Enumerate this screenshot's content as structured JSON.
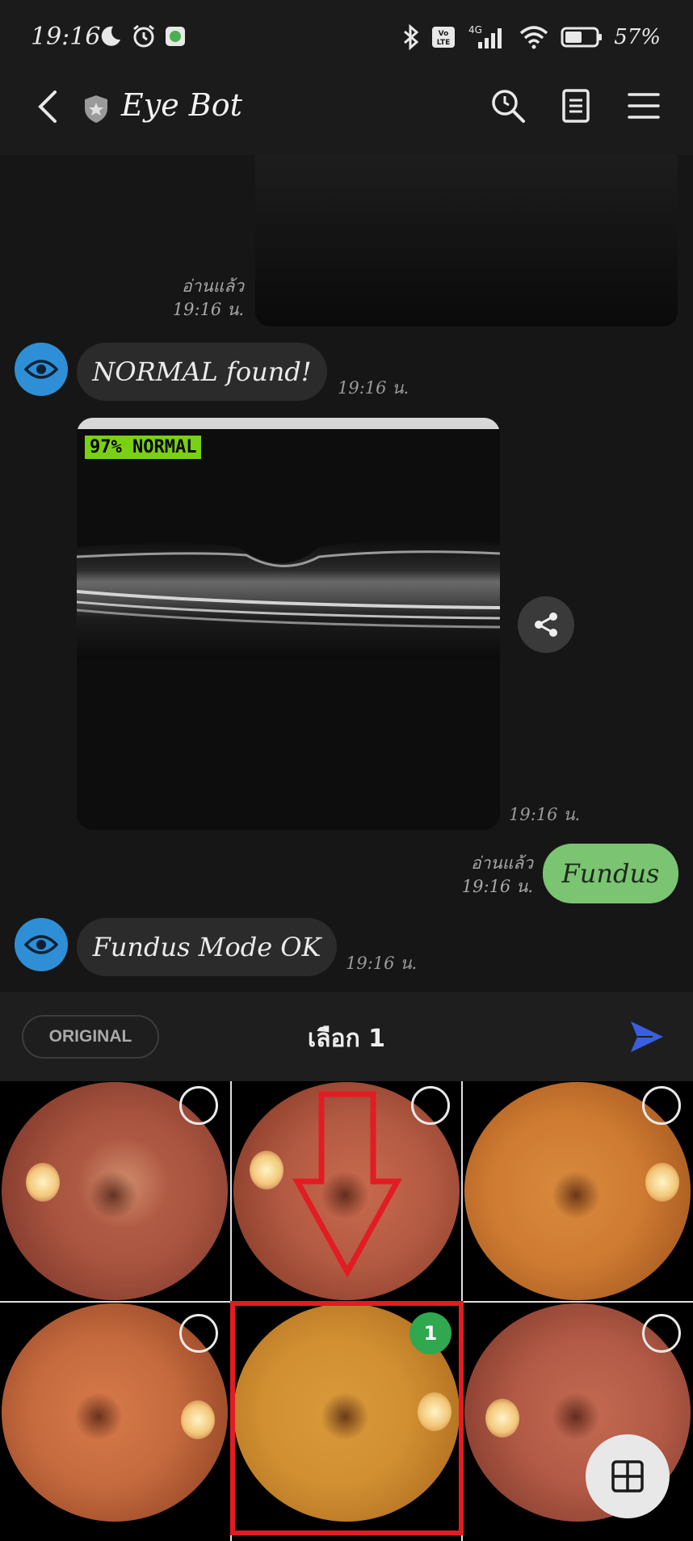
{
  "status_bar": {
    "time": "19:16",
    "network_label": "4G",
    "volte_label": "Vo LTE",
    "battery_percent": "57%"
  },
  "header": {
    "title": "Eye Bot"
  },
  "messages": {
    "first_read_label": "อ่านแล้ว",
    "first_read_time": "19:16 น.",
    "bot_msg_1": "NORMAL found!",
    "bot_msg_1_time": "19:16 น.",
    "oct_label": "97% NORMAL",
    "oct_time": "19:16 น.",
    "user_read_label": "อ่านแล้ว",
    "user_read_time": "19:16 น.",
    "user_msg": "Fundus",
    "bot_msg_2": "Fundus Mode OK",
    "bot_msg_2_time": "19:16 น."
  },
  "picker": {
    "original_label": "ORIGINAL",
    "selected_label": "เลือก 1",
    "selected_badge": "1"
  },
  "colors": {
    "accent_blue": "#3b5ee0",
    "bot_avatar": "#2f8fd6",
    "user_bubble": "#7bc472",
    "select_green": "#2fa84f",
    "highlight_red": "#e21c22"
  }
}
